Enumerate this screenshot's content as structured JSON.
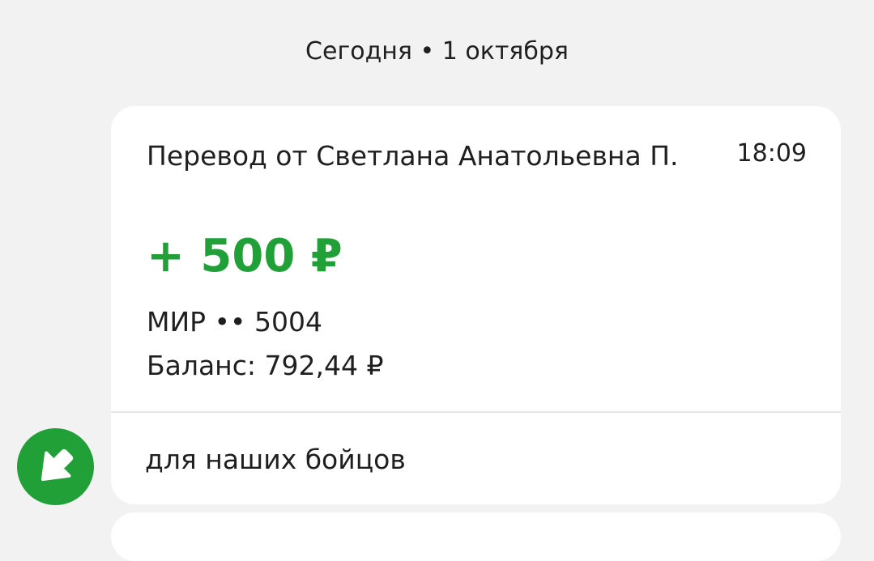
{
  "date_header": "Сегодня • 1 октября",
  "transaction": {
    "title": "Перевод от Светлана Анатольевна П.",
    "time": "18:09",
    "amount": "+ 500 ₽",
    "account": "МИР •• 5004",
    "balance": "Баланс: 792,44 ₽",
    "comment": "для наших бойцов"
  },
  "icons": {
    "incoming": "arrow-down-left-icon"
  },
  "colors": {
    "accent_green": "#21a038",
    "background": "#f2f2f2",
    "card": "#ffffff"
  }
}
